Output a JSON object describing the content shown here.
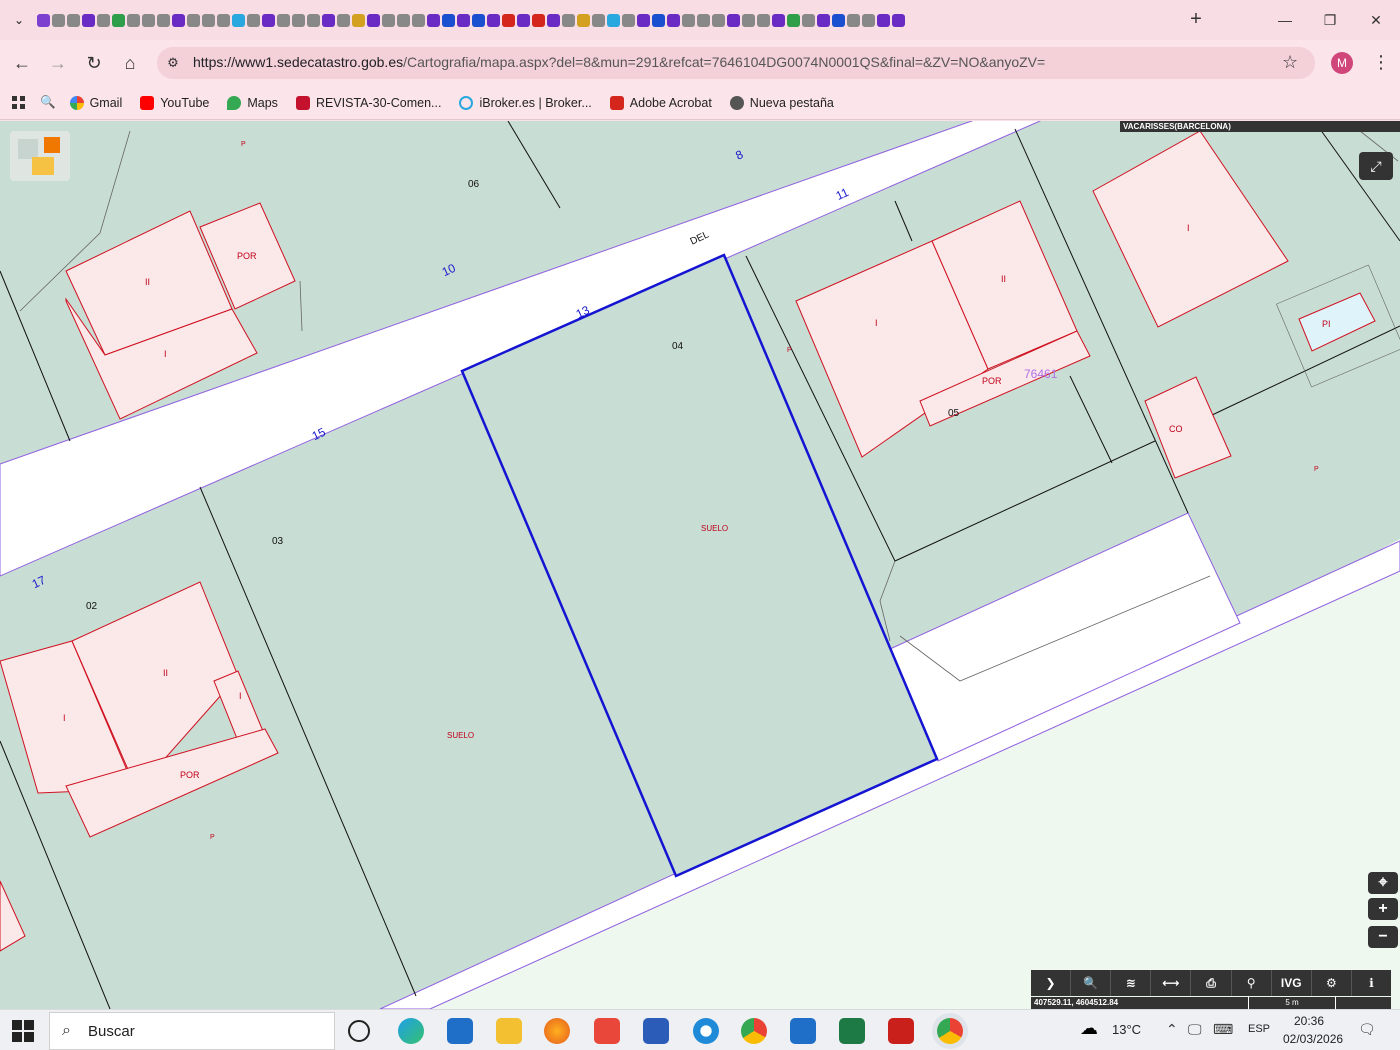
{
  "browser": {
    "new_tab_symbol": "+",
    "window_controls": {
      "minimize": "—",
      "restore": "❐",
      "close": "✕"
    },
    "url": {
      "host": "https://www1.sedecatastro.gob.es",
      "rest": "/Cartografia/mapa.aspx?del=8&mun=291&refcat=7646104DG0074N0001QS&final=&ZV=NO&anyoZV="
    },
    "profile_initial": "M",
    "bookmarks": [
      "Gmail",
      "YouTube",
      "Maps",
      "REVISTA-30-Comen...",
      "iBroker.es | Broker...",
      "Adobe Acrobat",
      "Nueva pestaña"
    ]
  },
  "map": {
    "municipality": "VACARISSES(BARCELONA)",
    "street_name": "DEL",
    "parcel_numbers": [
      "06",
      "04",
      "05",
      "03",
      "02"
    ],
    "street_numbers": [
      "8",
      "11",
      "10",
      "13",
      "15",
      "17"
    ],
    "building_labels": [
      "POR",
      "II",
      "I",
      "II",
      "I",
      "POR",
      "I",
      "PI",
      "CO",
      "II",
      "I",
      "I",
      "POR"
    ],
    "land_labels": [
      "SUELO",
      "SUELO"
    ],
    "p_labels": [
      "P",
      "P",
      "P",
      "P"
    ],
    "block_code": "76461",
    "coordinates": "407529.11, 4604512.84",
    "scale": "5 m",
    "toolbar_buttons": [
      "❯",
      "🔍",
      "≋",
      "⟷",
      "⎙",
      "⚲",
      "IVG",
      "⚙",
      "ℹ"
    ]
  },
  "taskbar": {
    "search_placeholder": "Buscar",
    "temperature": "13°C",
    "language": "ESP",
    "time": "20:36",
    "date": "02/03/2026"
  },
  "colors": {
    "tab_bg": "#f9dde4",
    "parcel_fill": "#c8ddd4",
    "building_fill": "#fbe8e8",
    "selected_parcel_border": "#1414d2",
    "street_border": "#8f5fe0"
  }
}
